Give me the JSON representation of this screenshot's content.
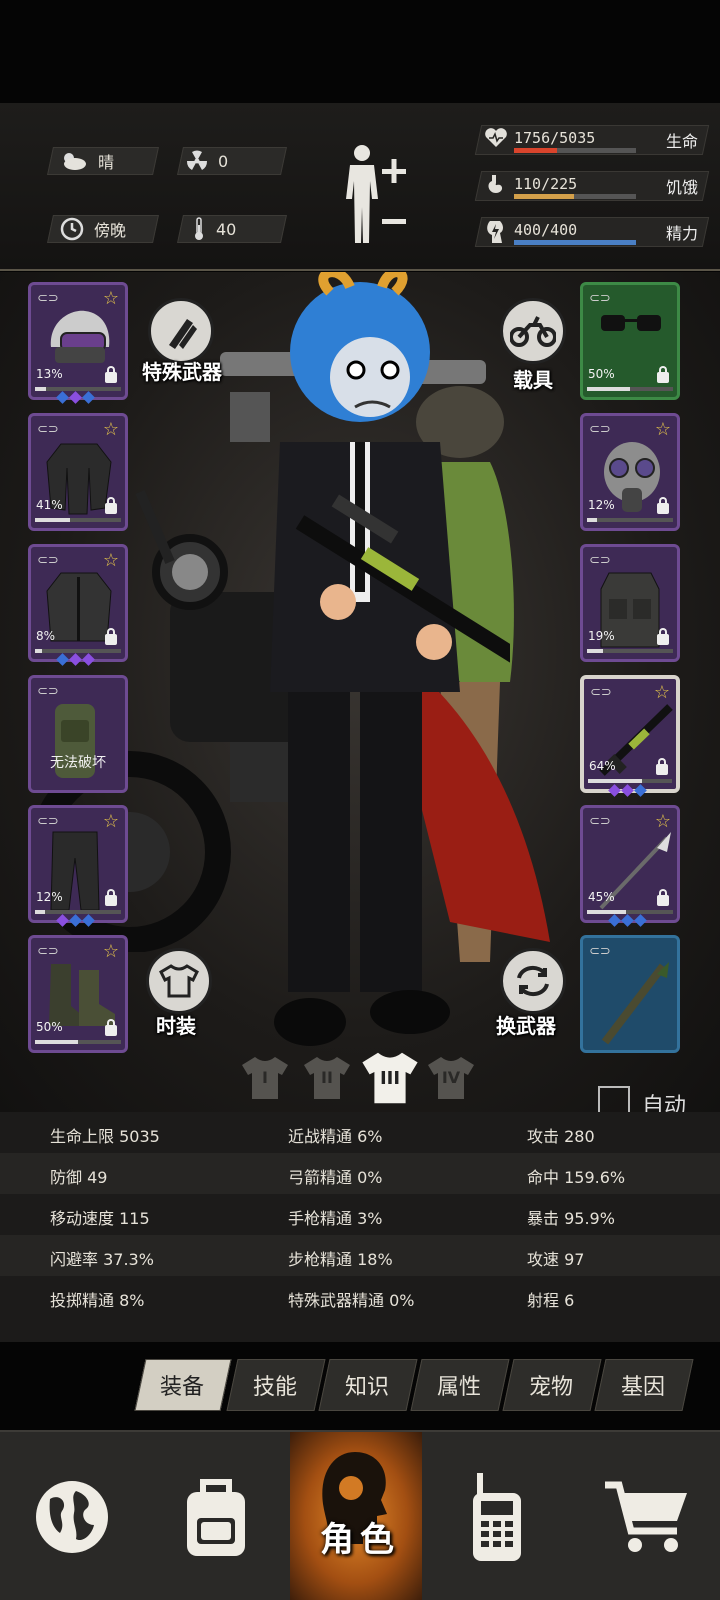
{
  "hud": {
    "weather": "晴",
    "radiation": "0",
    "time_of_day": "傍晚",
    "temperature": "40",
    "bars": [
      {
        "name": "生命",
        "value": "1756/5035",
        "fraction": 0.349,
        "color": "#d9442c",
        "icon": "heart-icon"
      },
      {
        "name": "饥饿",
        "value": "110/225",
        "fraction": 0.489,
        "color": "#d4a04a",
        "icon": "stomach-icon"
      },
      {
        "name": "精力",
        "value": "400/400",
        "fraction": 1.0,
        "color": "#4a7fc4",
        "icon": "energy-icon"
      }
    ]
  },
  "character": {
    "special_weapon_label": "特殊武器",
    "vehicle_label": "载具",
    "fashion_label": "时装",
    "swap_weapon_label": "换武器",
    "auto_label": "自动",
    "outfit_tabs": [
      "I",
      "II",
      "III",
      "IV"
    ],
    "active_outfit": "III"
  },
  "left_slots": [
    {
      "name": "helmet",
      "percent": "13%",
      "durability": 0.13,
      "star": true,
      "gems": [
        "#3a6fd6",
        "#8a4fe0",
        "#3a6fd6"
      ],
      "icon": "police-helmet-icon"
    },
    {
      "name": "jacket",
      "percent": "41%",
      "durability": 0.41,
      "star": true,
      "gems": [],
      "icon": "jacket-icon"
    },
    {
      "name": "coat",
      "percent": "8%",
      "durability": 0.08,
      "star": true,
      "gems": [
        "#3a6fd6",
        "#8a4fe0",
        "#8a4fe0"
      ],
      "icon": "coat-icon"
    },
    {
      "name": "backpack",
      "text": "无法破坏",
      "star": false,
      "gems": [],
      "icon": "backpack-icon"
    },
    {
      "name": "pants",
      "percent": "12%",
      "durability": 0.12,
      "star": true,
      "gems": [
        "#8a4fe0",
        "#3a6fd6",
        "#3a6fd6"
      ],
      "icon": "pants-icon"
    },
    {
      "name": "boots",
      "percent": "50%",
      "durability": 0.5,
      "star": true,
      "gems": [],
      "icon": "boots-icon"
    }
  ],
  "right_slots": [
    {
      "name": "glasses",
      "percent": "50%",
      "durability": 0.5,
      "star": false,
      "gems": [],
      "icon": "glasses-icon"
    },
    {
      "name": "gas-mask",
      "percent": "12%",
      "durability": 0.12,
      "star": true,
      "gems": [],
      "icon": "gas-mask-icon"
    },
    {
      "name": "vest",
      "percent": "19%",
      "durability": 0.19,
      "star": false,
      "gems": [],
      "icon": "vest-icon"
    },
    {
      "name": "rifle",
      "percent": "64%",
      "durability": 0.64,
      "star": true,
      "gems": [
        "#8a4fe0",
        "#8a4fe0",
        "#3a6fd6"
      ],
      "icon": "rifle-icon"
    },
    {
      "name": "spear",
      "percent": "45%",
      "durability": 0.45,
      "star": true,
      "gems": [
        "#3a6fd6",
        "#3a6fd6",
        "#3a6fd6"
      ],
      "icon": "spear-icon"
    },
    {
      "name": "melee",
      "percent": "",
      "durability": 0,
      "star": false,
      "gems": [],
      "icon": "rocket-launcher-icon"
    }
  ],
  "stats": [
    [
      "生命上限 5035",
      "近战精通 6%",
      "攻击 280"
    ],
    [
      "防御 49",
      "弓箭精通 0%",
      "命中 159.6%"
    ],
    [
      "移动速度 115",
      "手枪精通 3%",
      "暴击 95.9%"
    ],
    [
      "闪避率 37.3%",
      "步枪精通 18%",
      "攻速 97"
    ],
    [
      "投掷精通 8%",
      "特殊武器精通 0%",
      "射程 6"
    ]
  ],
  "tabs": [
    "装备",
    "技能",
    "知识",
    "属性",
    "宠物",
    "基因"
  ],
  "active_tab": "装备",
  "nav": {
    "items": [
      "globe-icon",
      "backpack-icon",
      "character-icon",
      "walkie-talkie-icon",
      "cart-icon"
    ],
    "active_label": "角色"
  }
}
